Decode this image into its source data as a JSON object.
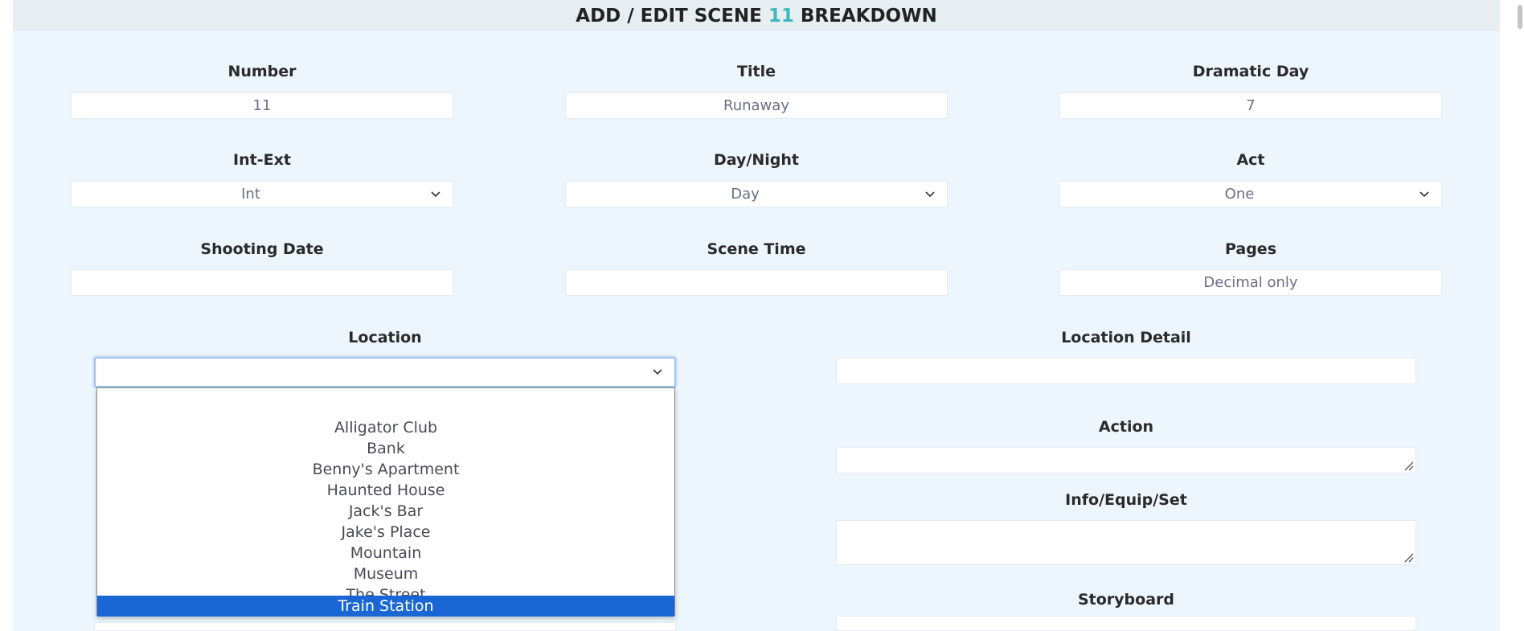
{
  "header": {
    "prefix": "ADD / EDIT SCENE",
    "scene_number": "11",
    "suffix": "BREAKDOWN"
  },
  "fields": {
    "number": {
      "label": "Number",
      "value": "11"
    },
    "title": {
      "label": "Title",
      "value": "Runaway"
    },
    "dramatic_day": {
      "label": "Dramatic Day",
      "value": "7"
    },
    "int_ext": {
      "label": "Int-Ext",
      "value": "Int"
    },
    "day_night": {
      "label": "Day/Night",
      "value": "Day"
    },
    "act": {
      "label": "Act",
      "value": "One"
    },
    "shooting_date": {
      "label": "Shooting Date",
      "value": ""
    },
    "scene_time": {
      "label": "Scene Time",
      "value": ""
    },
    "pages": {
      "label": "Pages",
      "placeholder": "Decimal only"
    },
    "location": {
      "label": "Location",
      "value": "",
      "options": [
        "",
        "Alligator Club",
        "Bank",
        "Benny's Apartment",
        "Haunted House",
        "Jack's Bar",
        "Jake's Place",
        "Mountain",
        "Museum",
        "The Street",
        "Train Station"
      ],
      "highlighted": "Train Station"
    },
    "location_detail": {
      "label": "Location Detail",
      "value": ""
    },
    "action": {
      "label": "Action",
      "value": ""
    },
    "info_equip_set": {
      "label": "Info/Equip/Set",
      "value": ""
    },
    "storyboard": {
      "label": "Storyboard"
    }
  },
  "colors": {
    "accent": "#3bb8c0",
    "highlight": "#1a66d4",
    "panel": "#edf5fd"
  }
}
